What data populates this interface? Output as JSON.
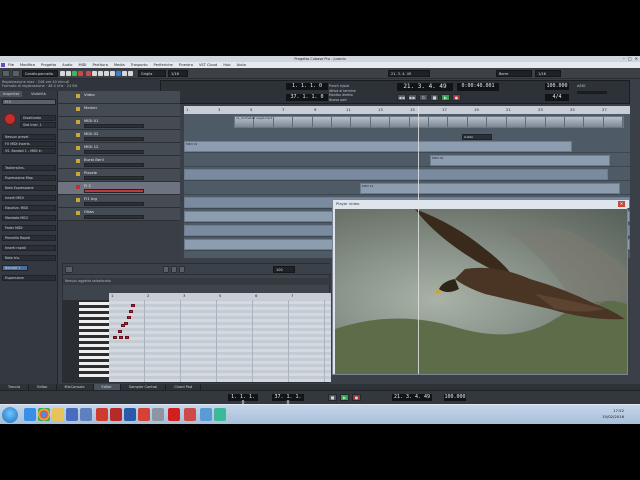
{
  "window": {
    "title": "Progetto Cubase Pro - Juranio",
    "minimize": "–",
    "maximize": "□",
    "close": "✕"
  },
  "menu": [
    "File",
    "Modifica",
    "Progetto",
    "Audio",
    "MIDI",
    "Partitura",
    "Media",
    "Trasporto",
    "Periferiche",
    "Finestra",
    "VST Cloud",
    "Hub",
    "Aiuto"
  ],
  "toolbar": {
    "mode": "Condiv.pannello",
    "snap_mode": "Griglia",
    "quantize": "1/16",
    "counter": "21. 3. 4. 49",
    "bars": "Barre"
  },
  "status": {
    "line1": "Registrazione max · 246 ore 40 minuti",
    "line2": "Formato di registrazione · 48.0 kHz · 24 Bit",
    "line3": "Decorso",
    "line4": "Solo"
  },
  "transport": {
    "position_primary": "21. 3. 4. 49",
    "time_primary": "0:00:40.001",
    "locator_left": "1. 1. 1. 0",
    "locator_right": "37. 1. 1. 0",
    "tempo": "100.000",
    "signature": "4/4",
    "punch_labels": [
      "Punch in/out",
      "Attiva al termine",
      "Monitor diretto",
      "Nuovo part"
    ],
    "left_time": "25. 1. 1. 0",
    "cpu_label": "ASIO"
  },
  "inspector": {
    "tabs": [
      "Inspector",
      "Visibilità"
    ],
    "track_name": "FI 2",
    "rows": [
      "Disattivato",
      "Slot Instr. 1",
      "Nessun preset",
      "FX MIDI Inserts",
      "VS. Bandali 1 - MIDI In"
    ],
    "sections": [
      "Tastiera/Ins.",
      "Espressione Map",
      "Nota Espressione",
      "Inserti MIDI",
      "Equalizz. MIDI",
      "Mandate MIDI",
      "Fader MIDI",
      "Pannello Rapidi",
      "Inserti rapidi",
      "Nota tris.",
      "Espansione"
    ],
    "sel_track": "Bandali 1"
  },
  "tracks": [
    {
      "name": "Video",
      "color": "#c9a83a"
    },
    {
      "name": "Marker",
      "color": "#c9a83a"
    },
    {
      "name": "MIDI 01",
      "color": "#c9a83a"
    },
    {
      "name": "MIDI 02",
      "color": "#c9a83a"
    },
    {
      "name": "MIDI 12",
      "color": "#c9a83a"
    },
    {
      "name": "Burst Berli",
      "color": "#c9a83a"
    },
    {
      "name": "Piazzle",
      "color": "#c9a83a"
    },
    {
      "name": "FI 2",
      "color": "#c03030"
    },
    {
      "name": "FI1 Ing",
      "color": "#c9a83a"
    },
    {
      "name": "Ollaa",
      "color": "#c9a83a"
    }
  ],
  "ruler": [
    "1",
    "3",
    "5",
    "7",
    "9",
    "11",
    "13",
    "15",
    "17",
    "19",
    "21",
    "23",
    "25",
    "27"
  ],
  "parts": {
    "video_label": "vs_Animated eagle.mp4",
    "marker_label": "2-Volo",
    "midi01": "MIDI 01",
    "midi02": "MIDI 02",
    "midi12": "MIDI 12"
  },
  "editor": {
    "status": "Nessun oggetto selezionato",
    "ruler": [
      "1",
      "2",
      "3",
      "5",
      "6",
      "7",
      "8"
    ],
    "range": "100"
  },
  "player": {
    "title": "Player video",
    "close": "✕"
  },
  "bottom_tabs": [
    "Traccia",
    "Editor",
    "MixConsole",
    "Editor",
    "Sampler Control",
    "Chord Pad"
  ],
  "bottom_transport": {
    "left": "1. 1. 1. 0",
    "right": "37. 1. 1. 0",
    "position": "21. 3. 4. 49",
    "tempo": "100.000"
  },
  "taskbar": {
    "time": "17:52",
    "date": "15/02/2016"
  }
}
